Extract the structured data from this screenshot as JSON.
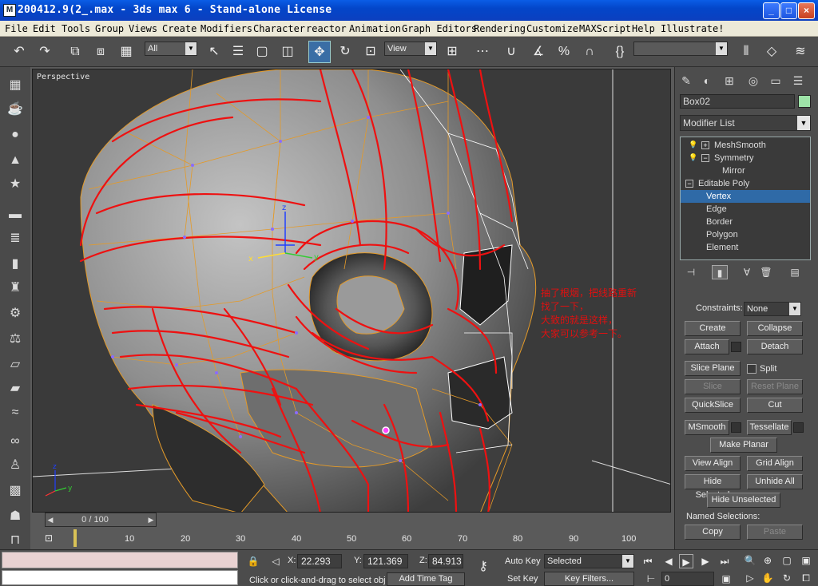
{
  "window": {
    "title": "200412.9(2_.max - 3ds max 6 - Stand-alone License",
    "minimize": "_",
    "maximize": "□",
    "close": "×"
  },
  "menu": [
    "File",
    "Edit",
    "Tools",
    "Group",
    "Views",
    "Create",
    "Modifiers",
    "Character",
    "reactor",
    "Animation",
    "Graph Editors",
    "Rendering",
    "Customize",
    "MAXScript",
    "Help",
    "Illustrate!"
  ],
  "toolbar": {
    "selection_filter": "All",
    "reference_coord": "View",
    "named_selection": ""
  },
  "viewport": {
    "label": "Perspective",
    "annotation": "抽了根烟，把线路重新\n找了一下，\n大致的就是这样，\n大家可以参考一下。"
  },
  "timeline": {
    "slider_text": "0 / 100",
    "ticks": [
      "10",
      "20",
      "30",
      "40",
      "50",
      "60",
      "70",
      "80",
      "90",
      "100"
    ]
  },
  "command_panel": {
    "object_name": "Box02",
    "modifier_list": "Modifier List",
    "stack": [
      {
        "label": "MeshSmooth",
        "level": 0
      },
      {
        "label": "Symmetry",
        "level": 0
      },
      {
        "label": "Mirror",
        "level": 1
      },
      {
        "label": "Editable Poly",
        "level": 0
      },
      {
        "label": "Vertex",
        "level": 1
      },
      {
        "label": "Edge",
        "level": 1
      },
      {
        "label": "Border",
        "level": 1
      },
      {
        "label": "Polygon",
        "level": 1
      },
      {
        "label": "Element",
        "level": 1
      }
    ],
    "constraints_label": "Constraints:",
    "constraints_value": "None",
    "buttons": {
      "create": "Create",
      "collapse": "Collapse",
      "attach": "Attach",
      "detach": "Detach",
      "slice_plane": "Slice Plane",
      "split": "Split",
      "slice": "Slice",
      "reset_plane": "Reset Plane",
      "quickslice": "QuickSlice",
      "cut": "Cut",
      "msmooth": "MSmooth",
      "tessellate": "Tessellate",
      "make_planar": "Make Planar",
      "view_align": "View Align",
      "grid_align": "Grid Align",
      "hide_selected": "Hide Selected",
      "unhide_all": "Unhide All",
      "hide_unselected": "Hide Unselected",
      "named_selections": "Named Selections:",
      "copy": "Copy",
      "paste": "Paste"
    }
  },
  "status": {
    "x_label": "X:",
    "x": "22.293",
    "y_label": "Y:",
    "y": "121.369",
    "z_label": "Z:",
    "z": "84.913",
    "prompt": "Click or click-and-drag to select obj",
    "add_time_tag": "Add Time Tag",
    "auto_key": "Auto Key",
    "set_key": "Set Key",
    "selected": "Selected",
    "key_filters": "Key Filters...",
    "frame": "0"
  }
}
